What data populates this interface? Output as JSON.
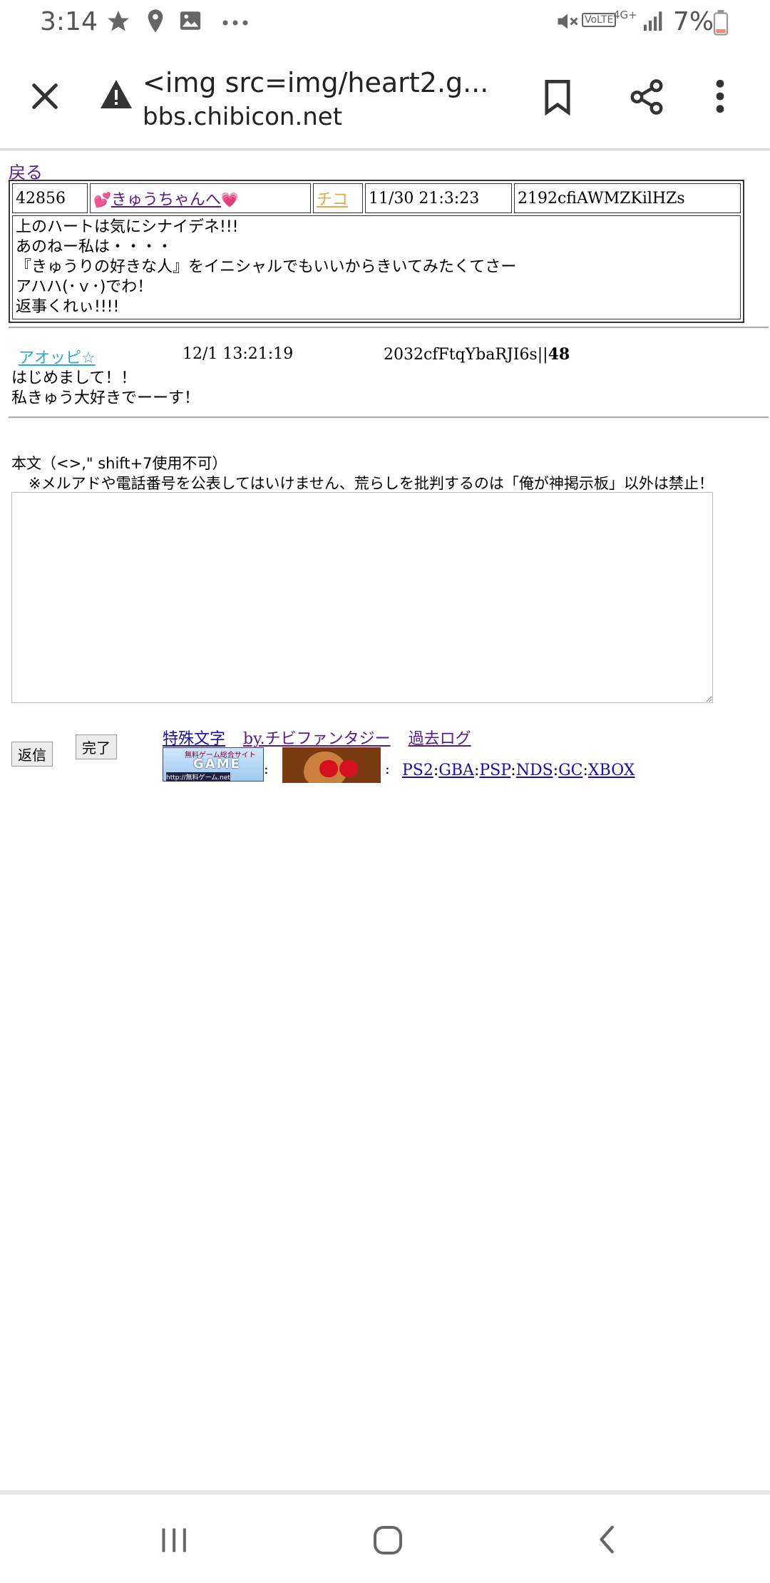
{
  "status_bar": {
    "time": "3:14",
    "network": "4G+",
    "volte": "VoLTE",
    "battery": "7%",
    "icons": [
      "star-icon",
      "location-icon",
      "gallery-icon",
      "more-dots-icon",
      "mute-icon",
      "signal-icon",
      "battery-icon"
    ]
  },
  "browser": {
    "page_title": "<img src=img/heart2.g...",
    "url": "bbs.chibicon.net",
    "icons": [
      "close-icon",
      "warning-icon",
      "bookmark-icon",
      "share-icon",
      "more-vert-icon"
    ]
  },
  "page": {
    "back_link": "戻る",
    "post": {
      "number": "42856",
      "title": "きゅうちゃんへ",
      "author": "チコ",
      "date": "11/30 21:3:23",
      "id": "2192cfiAWMZKilHZs",
      "body": [
        "上のハートは気にシナイデネ!!!",
        "あのねー私は・・・・",
        "『きゅうりの好きな人』をイニシャルでもいいからきいてみたくてさー",
        "アハハ(･ｖ･)でわ！",
        "返事くれぃ!!!!"
      ]
    },
    "reply": {
      "name": "アオッピ☆",
      "date": "12/1 13:21:19",
      "id_prefix": "2032cfFtqYbaRJI6s||",
      "id_number": "48",
      "lines": [
        "はじめまして！！",
        "私きゅう大好きでーーす！"
      ]
    },
    "form": {
      "body_label": "本文（<>,\" shift+7使用不可）",
      "notice": "※メルアドや電話番号を公表してはいけません、荒らしを批判するのは「俺が神掲示板」以外は禁止！",
      "textarea_value": "",
      "reply_button": "返信",
      "done_button": "完了"
    },
    "links": {
      "special_chars": "特殊文字",
      "by": "by.チビファンタジー",
      "past_log": "過去ログ",
      "banner_text_top": "無料ゲーム総合サイト",
      "banner_text_main": "GAME",
      "banner_text_url": "http://無料ゲーム.net",
      "colon": ":",
      "platforms": [
        "PS2",
        "GBA",
        "PSP",
        "NDS",
        "GC",
        "XBOX"
      ]
    }
  },
  "nav_bar": {
    "icons": [
      "recent-apps-icon",
      "home-icon",
      "back-icon"
    ]
  }
}
